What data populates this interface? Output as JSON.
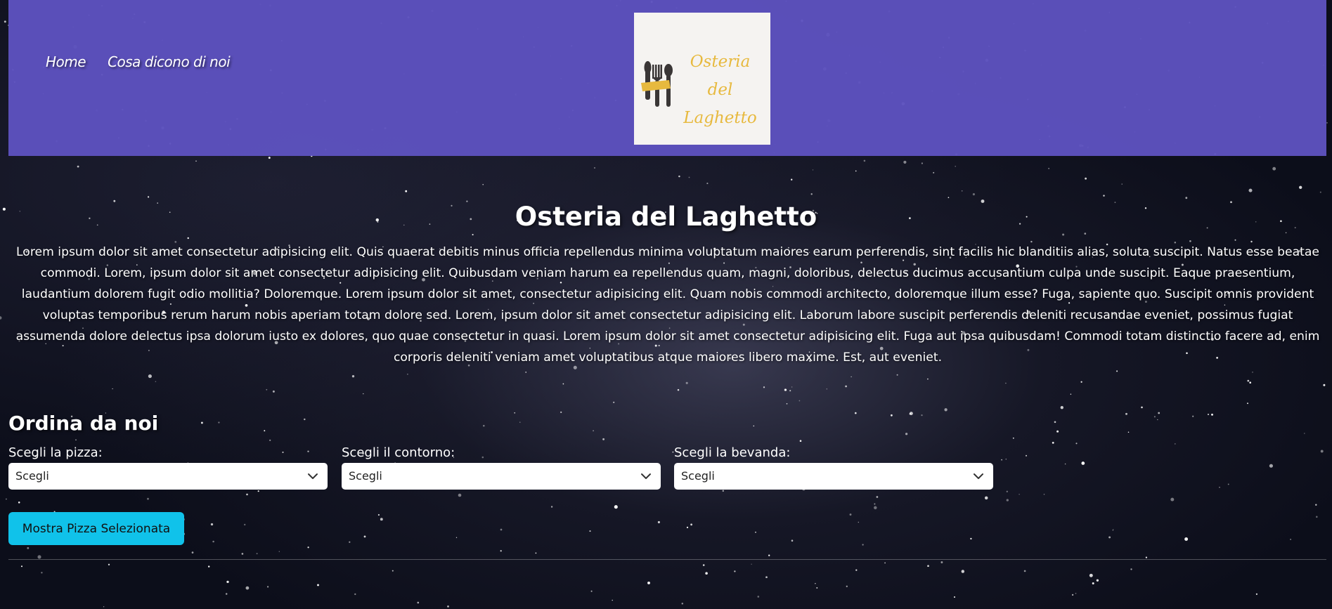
{
  "nav": {
    "items": [
      {
        "label": "Home"
      },
      {
        "label": "Cosa dicono di noi"
      }
    ]
  },
  "logo": {
    "line1": "Osteria del",
    "line2": "Laghetto",
    "icon": "cutlery-icon",
    "colors": {
      "text": "#e7b93e",
      "background": "#f5f3f1",
      "utensils": "#3a3636",
      "band": "#e7b93e"
    }
  },
  "main": {
    "title": "Osteria del Laghetto",
    "intro": "Lorem ipsum dolor sit amet consectetur adipisicing elit. Quis quaerat debitis minus officia repellendus minima voluptatum maiores earum perferendis, sint facilis hic blanditiis alias, soluta suscipit. Natus esse beatae commodi. Lorem, ipsum dolor sit amet consectetur adipisicing elit. Quibusdam veniam harum ea repellendus quam, magni, doloribus, delectus ducimus accusantium culpa unde suscipit. Eaque praesentium, laudantium dolorem fugit odio mollitia? Doloremque. Lorem ipsum dolor sit amet, consectetur adipisicing elit. Quam nobis commodi architecto, doloremque illum esse? Fuga, sapiente quo. Suscipit omnis provident voluptas temporibus rerum harum nobis aperiam totam dolore sed. Lorem, ipsum dolor sit amet consectetur adipisicing elit. Laborum labore suscipit perferendis deleniti recusandae eveniet, possimus fugiat assumenda dolore delectus ipsa dolorum iusto ex dolores, quo quae consectetur in quasi. Lorem ipsum dolor sit amet consectetur adipisicing elit. Fuga aut ipsa quibusdam! Commodi totam distinctio facere ad, enim corporis deleniti veniam amet voluptatibus atque maiores libero maxime. Est, aut eveniet."
  },
  "order": {
    "title": "Ordina da noi",
    "fields": [
      {
        "label": "Scegli la pizza:",
        "value": "Scegli"
      },
      {
        "label": "Scegli il contorno:",
        "value": "Scegli"
      },
      {
        "label": "Scegli la bevanda:",
        "value": "Scegli"
      }
    ],
    "button": "Mostra Pizza Selezionata"
  },
  "colors": {
    "header": "#5d52be",
    "button": "#10c2ea",
    "background": "#0c0e1a"
  }
}
